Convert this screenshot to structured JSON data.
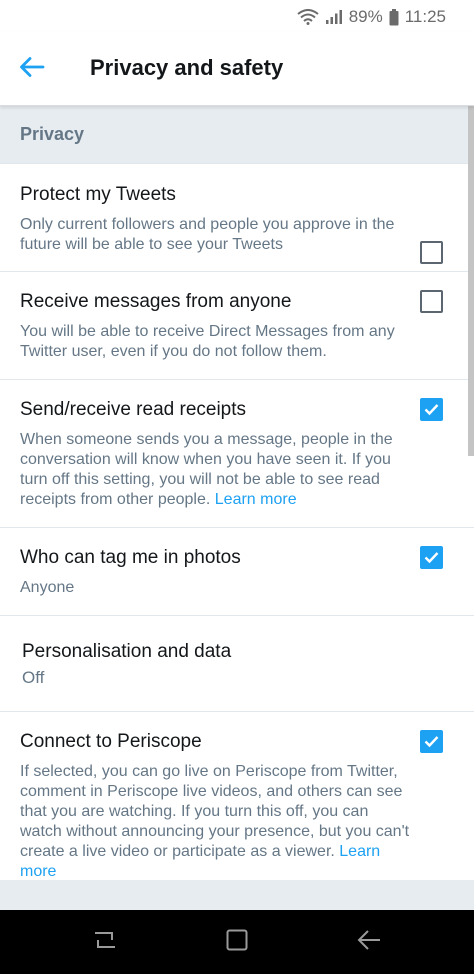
{
  "status_bar": {
    "battery_percent": "89%",
    "time": "11:25",
    "icons": [
      "wifi-icon",
      "signal-icon",
      "battery-icon"
    ]
  },
  "header": {
    "back_icon": "arrow-left-icon",
    "title": "Privacy and safety"
  },
  "section": {
    "title": "Privacy"
  },
  "settings": [
    {
      "title": "Protect my Tweets",
      "description": "Only current followers and people you approve in the future will be able to see your Tweets",
      "checked": false
    },
    {
      "title": "Receive messages from anyone",
      "description": "You will be able to receive Direct Messages from any Twitter user, even if you do not follow them.",
      "checked": false
    },
    {
      "title": "Send/receive read receipts",
      "description": "When someone sends you a message, people in the conversation will know when you have seen it. If you turn off this setting, you will not be able to see read receipts from other people.",
      "link": "Learn more",
      "checked": true
    },
    {
      "title": "Who can tag me in photos",
      "description": "Anyone",
      "checked": true
    },
    {
      "title": "Personalisation and data",
      "description": "Off"
    },
    {
      "title": "Connect to Periscope",
      "description": "If selected, you can go live on Periscope from Twitter, comment in Periscope live videos, and others can see that you are watching. If you turn this off, you can watch without announcing your presence, but you can't create a live video or participate as a viewer.",
      "link": "Learn more",
      "checked": true
    }
  ],
  "colors": {
    "accent": "#1da1f2",
    "section_bg": "#e6ecf0",
    "secondary_text": "#657786",
    "primary_text": "#14171a"
  },
  "nav_bar": {
    "icons": [
      "recent-apps-icon",
      "home-icon",
      "back-icon"
    ]
  }
}
